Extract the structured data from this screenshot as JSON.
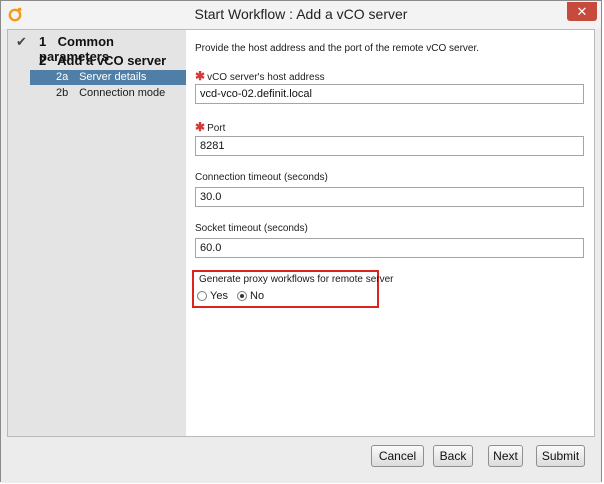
{
  "window": {
    "title": "Start Workflow : Add a vCO server",
    "close_glyph": "✕",
    "app_icon": "orchestrator-icon"
  },
  "sidebar": {
    "steps": [
      {
        "number": "1",
        "label": "Common parameters",
        "completed": true
      },
      {
        "number": "2",
        "label": "Add a vCO server",
        "completed": false
      }
    ],
    "substeps": [
      {
        "number": "2a",
        "label": "Server details",
        "selected": true
      },
      {
        "number": "2b",
        "label": "Connection mode",
        "selected": false
      }
    ]
  },
  "form": {
    "intro": "Provide the host address and the port of the remote vCO server.",
    "fields": [
      {
        "label": "vCO server's host address",
        "value": "vcd-vco-02.definit.local",
        "required": true
      },
      {
        "label": "Port",
        "value": "8281",
        "required": true
      },
      {
        "label": "Connection timeout (seconds)",
        "value": "30.0",
        "required": false
      },
      {
        "label": "Socket timeout (seconds)",
        "value": "60.0",
        "required": false
      }
    ],
    "required_marker": "✱",
    "proxy": {
      "label": "Generate proxy workflows for remote server",
      "options": [
        "Yes",
        "No"
      ],
      "selected": "No"
    }
  },
  "buttons": {
    "cancel": "Cancel",
    "back": "Back",
    "next": "Next",
    "submit": "Submit"
  },
  "colors": {
    "selected_substep": "#4f7ea6",
    "highlight_box": "#d9251c",
    "close_button": "#c74b3c",
    "required_marker": "#d53a3a"
  }
}
